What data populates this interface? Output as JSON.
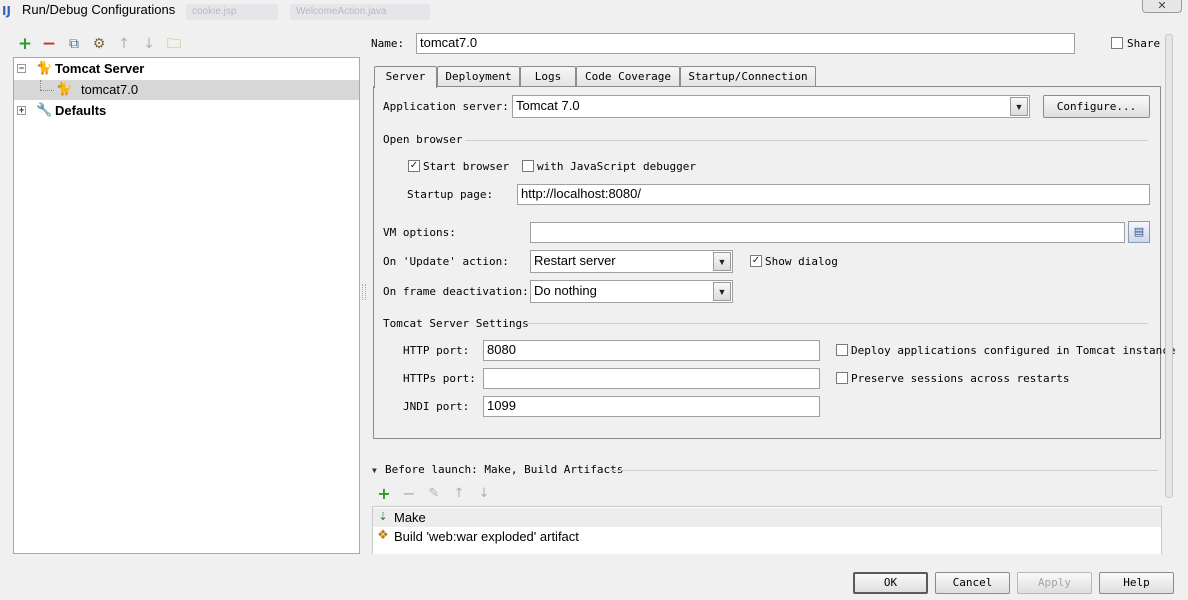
{
  "window": {
    "title": "Run/Debug Configurations",
    "close_glyph": "✕"
  },
  "background_tabs": [
    "cookie.jsp",
    "WelcomeAction.java"
  ],
  "toolbar": {
    "add": "+",
    "remove": "−",
    "copy": "⧉",
    "edit_defaults": "⚙",
    "move_up": "↑",
    "move_down": "↓",
    "folder": "🗀"
  },
  "tree": {
    "items": [
      {
        "label": "Tomcat Server",
        "expander": "−",
        "icon": "tomcat-icon"
      },
      {
        "label": "tomcat7.0",
        "icon": "tomcat-icon",
        "selected": true
      },
      {
        "label": "Defaults",
        "expander": "+",
        "icon": "wrench-icon"
      }
    ]
  },
  "form": {
    "name_label": "Name:",
    "name_value": "tomcat7.0",
    "share_label": "Share",
    "share_checked": false
  },
  "tabs": [
    {
      "label": "Server",
      "active": true
    },
    {
      "label": "Deployment"
    },
    {
      "label": "Logs"
    },
    {
      "label": "Code Coverage"
    },
    {
      "label": "Startup/Connection"
    }
  ],
  "server": {
    "app_server_label": "Application server:",
    "app_server_value": "Tomcat 7.0",
    "configure_label": "Configure...",
    "open_browser_group": "Open browser",
    "start_browser_label": "Start browser",
    "start_browser_checked": "✓",
    "js_debugger_label": "with JavaScript debugger",
    "startup_page_label": "Startup page:",
    "startup_page_value": "http://localhost:8080/",
    "vm_options_label": "VM options:",
    "vm_options_value": "",
    "on_update_label": "On 'Update' action:",
    "on_update_value": "Restart server",
    "show_dialog_label": "Show dialog",
    "show_dialog_checked": "✓",
    "on_frame_label": "On frame deactivation:",
    "on_frame_value": "Do nothing",
    "tomcat_group": "Tomcat Server Settings",
    "http_port_label": "HTTP port:",
    "http_port_value": "8080",
    "https_port_label": "HTTPs port:",
    "https_port_value": "",
    "jndi_port_label": "JNDI port:",
    "jndi_port_value": "1099",
    "deploy_label": "Deploy applications configured in Tomcat instance",
    "preserve_label": "Preserve sessions across restarts"
  },
  "before_launch": {
    "header": "Before launch: Make, Build Artifacts",
    "add": "+",
    "remove": "−",
    "edit": "✎",
    "up": "↑",
    "down": "↓",
    "items": [
      {
        "label": "Make",
        "icon": "make-icon"
      },
      {
        "label": "Build 'web:war exploded' artifact",
        "icon": "artifact-icon"
      }
    ]
  },
  "buttons": {
    "ok": "OK",
    "cancel": "Cancel",
    "apply": "Apply",
    "help": "Help"
  },
  "colors": {
    "add_green": "#2e9b2e",
    "remove_red": "#d32f2f",
    "selection": "#d7d7d7"
  }
}
